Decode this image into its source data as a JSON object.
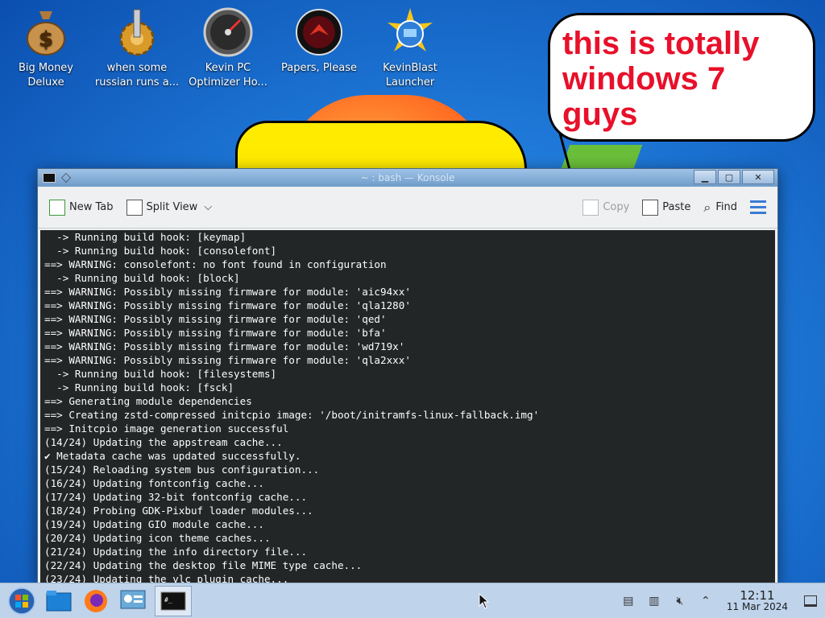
{
  "desktop": {
    "icons": [
      {
        "label": "Big Money\nDeluxe",
        "line1": "Big Money",
        "line2": "Deluxe",
        "icon": "money-bag-icon"
      },
      {
        "label": "when some russian runs a...",
        "line1": "when some",
        "line2": "russian runs a...",
        "icon": "gear-icon"
      },
      {
        "label": "Kevin PC Optimizer Ho...",
        "line1": "Kevin PC",
        "line2": "Optimizer Ho...",
        "icon": "speedometer-icon"
      },
      {
        "label": "Papers, Please",
        "line1": "Papers, Please",
        "line2": "",
        "icon": "papers-please-icon"
      },
      {
        "label": "KevinBlast Launcher",
        "line1": "KevinBlast",
        "line2": "Launcher",
        "icon": "globe-disc-icon"
      }
    ],
    "bubble_text": "this is totally windows 7 guys"
  },
  "window": {
    "title": "~ : bash — Konsole",
    "toolbar": {
      "new_tab": "New Tab",
      "split_view": "Split View",
      "copy": "Copy",
      "paste": "Paste",
      "find": "Find"
    },
    "terminal_lines": [
      "  -> Running build hook: [keymap]",
      "  -> Running build hook: [consolefont]",
      "==> WARNING: consolefont: no font found in configuration",
      "  -> Running build hook: [block]",
      "==> WARNING: Possibly missing firmware for module: 'aic94xx'",
      "==> WARNING: Possibly missing firmware for module: 'qla1280'",
      "==> WARNING: Possibly missing firmware for module: 'qed'",
      "==> WARNING: Possibly missing firmware for module: 'bfa'",
      "==> WARNING: Possibly missing firmware for module: 'wd719x'",
      "==> WARNING: Possibly missing firmware for module: 'qla2xxx'",
      "  -> Running build hook: [filesystems]",
      "  -> Running build hook: [fsck]",
      "==> Generating module dependencies",
      "==> Creating zstd-compressed initcpio image: '/boot/initramfs-linux-fallback.img'",
      "==> Initcpio image generation successful",
      "(14/24) Updating the appstream cache...",
      "✔ Metadata cache was updated successfully.",
      "(15/24) Reloading system bus configuration...",
      "(16/24) Updating fontconfig cache...",
      "(17/24) Updating 32-bit fontconfig cache...",
      "(18/24) Probing GDK-Pixbuf loader modules...",
      "(19/24) Updating GIO module cache...",
      "(20/24) Updating icon theme caches...",
      "(21/24) Updating the info directory file...",
      "(22/24) Updating the desktop file MIME type cache...",
      "(23/24) Updating the vlc plugin cache..."
    ]
  },
  "taskbar": {
    "items": [
      "start-orb-icon",
      "file-manager-icon",
      "firefox-icon",
      "system-settings-icon",
      "konsole-icon"
    ],
    "clock_time": "12:11",
    "clock_date": "11 Mar 2024"
  }
}
